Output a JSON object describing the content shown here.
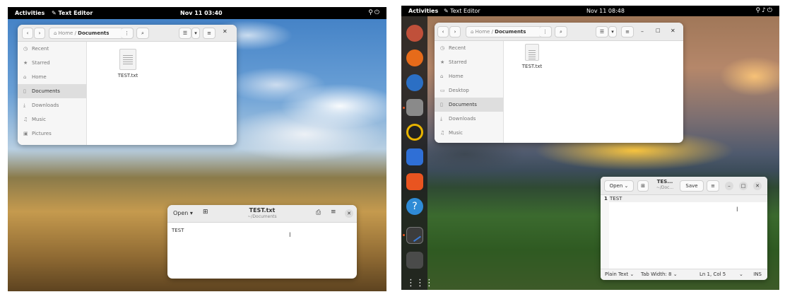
{
  "screen1": {
    "topbar": {
      "activities": "Activities",
      "app": "Text Editor",
      "clock": "Nov 11  03:40"
    },
    "files": {
      "path": {
        "home": "Home",
        "current": "Documents"
      },
      "sidebar": [
        {
          "icon": "recent-icon",
          "glyph": "◷",
          "label": "Recent"
        },
        {
          "icon": "star-icon",
          "glyph": "★",
          "label": "Starred"
        },
        {
          "icon": "home-icon",
          "glyph": "⌂",
          "label": "Home"
        },
        {
          "icon": "document-icon",
          "glyph": "▯",
          "label": "Documents",
          "selected": true
        },
        {
          "icon": "download-icon",
          "glyph": "⤓",
          "label": "Downloads"
        },
        {
          "icon": "music-icon",
          "glyph": "♫",
          "label": "Music"
        },
        {
          "icon": "picture-icon",
          "glyph": "▣",
          "label": "Pictures"
        }
      ],
      "file_name": "TEST.txt"
    },
    "editor": {
      "open": "Open",
      "title": "TEST.txt",
      "subtitle": "~/Documents",
      "content": "TEST"
    }
  },
  "screen2": {
    "topbar": {
      "activities": "Activities",
      "app": "Text Editor",
      "clock": "Nov 11  08:48"
    },
    "files": {
      "path": {
        "home": "Home",
        "current": "Documents"
      },
      "sidebar": [
        {
          "icon": "recent-icon",
          "glyph": "◷",
          "label": "Recent"
        },
        {
          "icon": "star-icon",
          "glyph": "★",
          "label": "Starred"
        },
        {
          "icon": "home-icon",
          "glyph": "⌂",
          "label": "Home"
        },
        {
          "icon": "desktop-icon",
          "glyph": "▭",
          "label": "Desktop"
        },
        {
          "icon": "document-icon",
          "glyph": "▯",
          "label": "Documents",
          "selected": true
        },
        {
          "icon": "download-icon",
          "glyph": "⤓",
          "label": "Downloads"
        },
        {
          "icon": "music-icon",
          "glyph": "♫",
          "label": "Music"
        }
      ],
      "file_name": "TEST.txt"
    },
    "editor": {
      "open": "Open",
      "title": "TES...",
      "subtitle": "~/Doc...",
      "save": "Save",
      "line_number": "1",
      "content": "TEST",
      "status": {
        "language": "Plain Text",
        "tab_width": "Tab Width: 8",
        "position": "Ln 1, Col 5",
        "mode": "INS"
      }
    }
  },
  "colors": {
    "topbar": "#000000",
    "ubuntu_accent": "#e95420",
    "selection": "#dedede"
  }
}
